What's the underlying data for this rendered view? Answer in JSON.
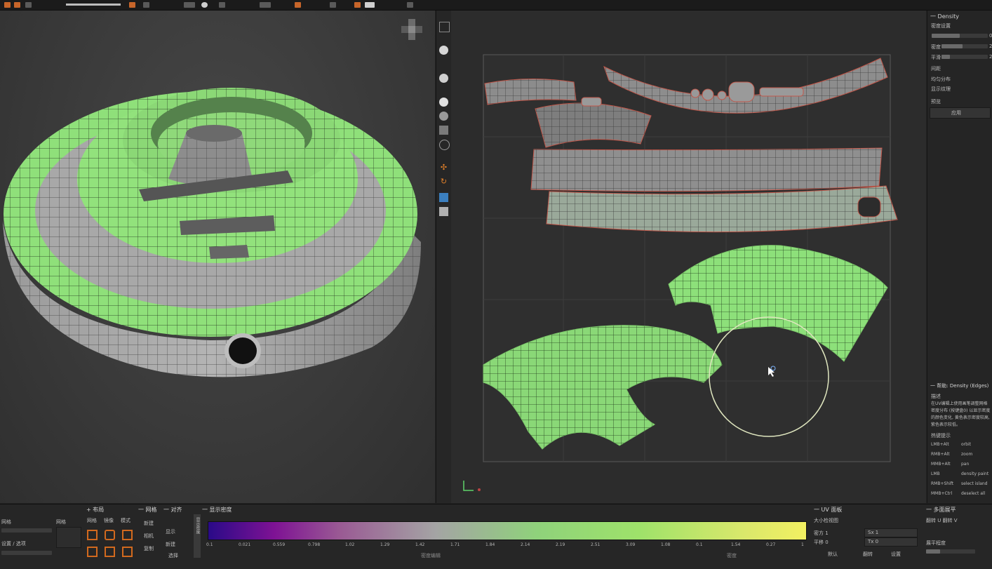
{
  "panels": {
    "right": {
      "title": "Density",
      "row0": "密度设置",
      "rows": [
        {
          "label": "",
          "value": "0"
        },
        {
          "label": "密度",
          "value": "2"
        },
        {
          "label": "平滑",
          "value": "2"
        }
      ],
      "items": [
        "间距",
        "均匀分布",
        "显示纹理",
        "预览"
      ],
      "button": "应用"
    },
    "help": {
      "title": "帮助: Density (Edges)",
      "sub": "描述",
      "desc": "在UV编辑上使用画笔调整网格密度分布 (按键盘0) 以显示密度的颜色变化, 黄色表示密度较高, 紫色表示较低。",
      "hotkeys_title": "热键提示",
      "hotkeys": [
        {
          "k": "LMB+Alt",
          "v": "orbit"
        },
        {
          "k": "RMB+Alt",
          "v": "zoom"
        },
        {
          "k": "MMB+Alt",
          "v": "pan"
        },
        {
          "k": "LMB",
          "v": "density paint"
        },
        {
          "k": "RMB+Shift",
          "v": "select island"
        },
        {
          "k": "MMB+Ctrl",
          "v": "deselect all"
        }
      ]
    }
  },
  "bottom": {
    "sections": [
      "+ 布局",
      "一 网格",
      "一 对齐",
      "一 显示密度"
    ],
    "uv_title": "一 UV 面板",
    "uv_sub": "大小检视图",
    "uv_fields": [
      {
        "label": "密方 1",
        "value": "Sx 1"
      },
      {
        "label": "平移 0",
        "value": "Tx 0"
      }
    ],
    "poly_title": "一 多面展平",
    "poly_sub": "翻转 U  翻转 V",
    "poly_label": "展平程度",
    "left_labels": [
      "网格",
      "设置 / 选项"
    ],
    "col_labels": [
      "网格",
      "镜像",
      "模式"
    ],
    "grid_labels": [
      "新建",
      "相机",
      "复制",
      "显示"
    ],
    "density_ticks": [
      "0.1",
      "0.021",
      "0.559",
      "0.798",
      "1.02",
      "1.29",
      "1.42",
      "1.71",
      "1.84",
      "2.14",
      "2.19",
      "2.51",
      "3.09",
      "1.08",
      "0.1",
      "1.54",
      "0.27",
      "1"
    ],
    "density_captions": [
      "选择",
      "密度编辑",
      "",
      "密度"
    ],
    "right_actions": [
      "默认",
      "翻转",
      "设置"
    ],
    "vertical_label": "显示密度"
  }
}
